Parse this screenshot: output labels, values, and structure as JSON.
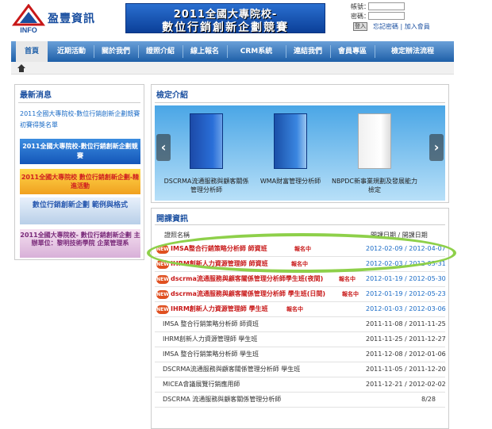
{
  "site": {
    "logo_text": "盈豐資訊",
    "logo_mark": "INFO"
  },
  "banner": {
    "line1": "2011全國大專院校-",
    "line2": "數位行銷創新企劃競賽"
  },
  "login": {
    "account_label": "帳號：",
    "password_label": "密碼：",
    "login_button": "登入",
    "links": "忘記密碼 | 加入會員"
  },
  "nav": {
    "items": [
      {
        "label": "首頁"
      },
      {
        "label": "近期活動"
      },
      {
        "label": "關於我們"
      },
      {
        "label": "證照介紹"
      },
      {
        "label": "線上報名"
      },
      {
        "label": "CRM系統"
      },
      {
        "label": "連結我們"
      },
      {
        "label": "會員專區"
      },
      {
        "label": "檢定辦法流程"
      }
    ]
  },
  "news": {
    "title": "最新消息",
    "link": "2011全國大專院校-數位行銷創新企劃競賽 初賽得獎名單",
    "thumb1": "2011全國大專院校-數位行銷創新企劃競賽",
    "thumb2": "2011全國大專院校 數位行銷創新企劃-精進活動",
    "thumb3": "數位行銷創新企劃 範例與格式",
    "thumb4": "2011全國大專院校- 數位行銷創新企劃 主辦單位：黎明技術學院 企業管理系"
  },
  "cert": {
    "title": "檢定介紹",
    "prev_arrow": "‹",
    "next_arrow": "›",
    "items": [
      {
        "label": "DSCRMA流通服務與顧客關係管理分析師"
      },
      {
        "label": "WMA財富管理分析師"
      },
      {
        "label": "NBPDC新事業規劃及發展能力檢定"
      }
    ]
  },
  "courses": {
    "title": "開課資訊",
    "col_name": "證照名稱",
    "col_date": "開課日期 / 開課日期",
    "rows": [
      {
        "new": "NEW",
        "title": "IMSA整合行銷策略分析師 師資班",
        "tag": "報名中",
        "date": "2012-02-09 / 2012-04-07"
      },
      {
        "new": "NEW",
        "title": "IHRM創新人力資源管理師 師資班",
        "tag": "報名中",
        "date": "2012-02-03 / 2012-03-31"
      },
      {
        "new": "NEW",
        "title": "dscrma流通服務與顧客關係管理分析師學生班(夜間)",
        "tag": "報名中",
        "date": "2012-01-19 / 2012-05-30"
      },
      {
        "new": "NEW",
        "title": "dscrma流通服務與顧客關係管理分析師 學生班(日間)",
        "tag": "報名中",
        "date": "2012-01-19 / 2012-05-23"
      },
      {
        "new": "NEW",
        "title": "IHRM創新人力資源管理師 學生班",
        "tag": "報名中",
        "date": "2012-01-03 / 2012-03-06"
      },
      {
        "new": "",
        "title": "IMSA 整合行銷策略分析師 師資班",
        "tag": "",
        "date": "2011-11-08 / 2011-11-25"
      },
      {
        "new": "",
        "title": "IHRM創新人力資源管理師 學生班",
        "tag": "",
        "date": "2011-11-25 / 2011-12-27"
      },
      {
        "new": "",
        "title": "IMSA 整合行銷策略分析師 學生班",
        "tag": "",
        "date": "2011-12-08 / 2012-01-06"
      },
      {
        "new": "",
        "title": "DSCRMA流通服務與顧客關係管理分析師 學生班",
        "tag": "",
        "date": "2011-11-05 / 2011-12-20"
      },
      {
        "new": "",
        "title": "MICEA會議展覽行銷應用師",
        "tag": "",
        "date": "2011-12-21 / 2012-02-02"
      },
      {
        "new": "",
        "title": "DSCRMA 流通服務與顧客關係管理分析師",
        "tag": "",
        "date": "8/28"
      }
    ]
  }
}
